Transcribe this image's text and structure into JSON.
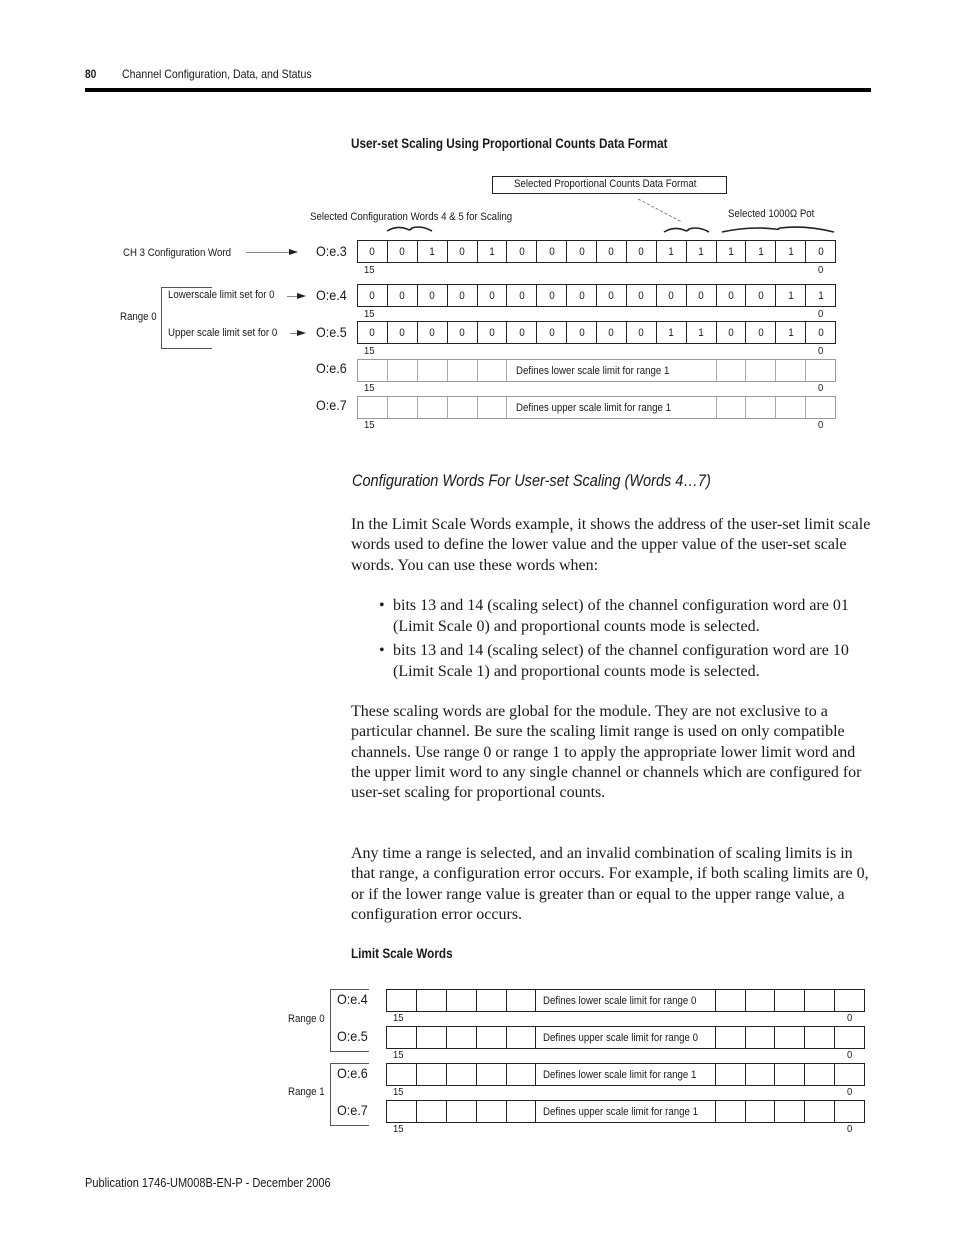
{
  "header": {
    "page_number": "80",
    "running_head": "Channel Configuration, Data, and Status"
  },
  "figure1": {
    "title": "User-set Scaling Using Proportional Counts Data Format",
    "callout_box": "Selected Proportional Counts Data Format",
    "label_config_words": "Selected Configuration Words 4 & 5 for Scaling",
    "label_pot": "Selected 1000Ω Pot",
    "label_ch3": "CH 3 Configuration Word",
    "label_range0": "Range 0",
    "label_lower": "Lowerscale limit set for 0",
    "label_upper": "Upper scale limit set for 0",
    "bit_high": "15",
    "bit_low": "0",
    "rows": [
      {
        "address": "O:e.3",
        "bits": [
          "0",
          "0",
          "1",
          "0",
          "1",
          "0",
          "0",
          "0",
          "0",
          "0",
          "1",
          "1",
          "1",
          "1",
          "1",
          "0"
        ]
      },
      {
        "address": "O:e.4",
        "bits": [
          "0",
          "0",
          "0",
          "0",
          "0",
          "0",
          "0",
          "0",
          "0",
          "0",
          "0",
          "0",
          "0",
          "0",
          "1",
          "1"
        ]
      },
      {
        "address": "O:e.5",
        "bits": [
          "0",
          "0",
          "0",
          "0",
          "0",
          "0",
          "0",
          "0",
          "0",
          "0",
          "1",
          "1",
          "0",
          "0",
          "1",
          "0"
        ]
      },
      {
        "address": "O:e.6",
        "description": "Defines lower scale limit for range 1"
      },
      {
        "address": "O:e.7",
        "description": "Defines upper scale limit for range 1"
      }
    ]
  },
  "section": {
    "subheading": "Configuration Words For User-set Scaling (Words 4…7)",
    "intro": "In the Limit Scale Words example, it shows the address of the user-set limit scale words used to define the lower value and the upper value of the user-set scale words. You can use these words when:",
    "bullets": [
      "bits 13 and 14 (scaling select) of the channel configuration word are 01 (Limit Scale 0) and proportional counts mode is selected.",
      "bits 13 and 14 (scaling select) of the channel configuration word are 10 (Limit Scale 1) and proportional counts mode is selected."
    ],
    "para2": "These scaling words are global for the module. They are not exclusive to a particular channel. Be sure the scaling limit range is used on only compatible channels. Use range 0 or range 1 to apply the appropriate lower limit word and the upper limit word to any single channel or channels which are configured for user-set scaling for proportional counts.",
    "para3": "Any time a range is selected, and an invalid combination of scaling limits is in that range, a configuration error occurs. For example, if both scaling limits are 0, or if the lower range value is greater than or equal to the upper range value, a configuration error occurs."
  },
  "figure2": {
    "title": "Limit Scale Words",
    "bit_high": "15",
    "bit_low": "0",
    "ranges": [
      {
        "label": "Range 0",
        "rows": [
          {
            "address": "O:e.4",
            "description": "Defines lower scale limit for range 0"
          },
          {
            "address": "O:e.5",
            "description": "Defines upper scale limit for range 0"
          }
        ]
      },
      {
        "label": "Range 1",
        "rows": [
          {
            "address": "O:e.6",
            "description": "Defines lower scale limit for range 1"
          },
          {
            "address": "O:e.7",
            "description": "Defines upper scale limit for range 1"
          }
        ]
      }
    ]
  },
  "footer": {
    "publication": "Publication 1746-UM008B-EN-P - December 2006"
  }
}
